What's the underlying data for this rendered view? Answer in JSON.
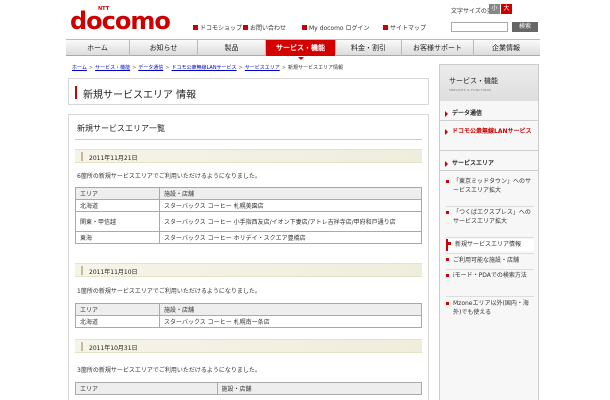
{
  "header": {
    "logo_ntt": "NTT",
    "logo_text": "docomo",
    "font_size_label": "文字サイズの変更",
    "font_small": "小",
    "font_large": "大",
    "search_placeholder": "",
    "search_button": "検索",
    "links": [
      {
        "label": "ドコモショップ"
      },
      {
        "label": "お問い合わせ"
      },
      {
        "label": "My docomo ログイン"
      },
      {
        "label": "サイトマップ"
      }
    ]
  },
  "gnav": [
    {
      "label": "ホーム"
    },
    {
      "label": "お知らせ"
    },
    {
      "label": "製品"
    },
    {
      "label": "サービス・機能",
      "active": true
    },
    {
      "label": "料金・割引"
    },
    {
      "label": "お客様サポート"
    },
    {
      "label": "企業情報"
    }
  ],
  "breadcrumb": [
    {
      "label": "ホーム"
    },
    {
      "label": "サービス・機能"
    },
    {
      "label": "データ通信"
    },
    {
      "label": "ドコモ公衆無線LANサービス"
    },
    {
      "label": "サービスエリア"
    },
    {
      "label": "新規サービスエリア情報"
    }
  ],
  "page_title": "新規サービスエリア 情報",
  "section_title": "新規サービスエリア一覧",
  "table_headers": {
    "area": "エリア",
    "facility": "施設・店舗"
  },
  "entries": [
    {
      "date": "2011年11月21日",
      "intro": "6箇所の新規サービスエリアでご利用いただけるようになりました。",
      "rows": [
        {
          "area": "北海道",
          "facility": "スターバックス コーヒー 札幌美園店"
        },
        {
          "area": "関東・甲信越",
          "facility": "スターバックス コーヒー 小手指西友店/イオン下妻店/アトレ吉祥寺店/甲府和戸通り店"
        },
        {
          "area": "東海",
          "facility": "スターバックス コーヒー ホリデイ・スクエア豊橋店"
        }
      ]
    },
    {
      "date": "2011年11月10日",
      "intro": "1箇所の新規サービスエリアでご利用いただけるようになりました。",
      "rows": [
        {
          "area": "北海道",
          "facility": "スターバックス コーヒー 札幌南一条店"
        }
      ]
    },
    {
      "date": "2011年10月31日",
      "intro": "3箇所の新規サービスエリアでご利用いただけるようになりました。",
      "rows": []
    }
  ],
  "sidebar": {
    "title": "サービス・機能",
    "subtitle": "SERVICES & FUNCTIONS",
    "sections": [
      {
        "label": "データ通信",
        "red": false
      },
      {
        "label": "ドコモ公衆無線LANサービス",
        "red": true
      },
      {
        "label": "サービスエリア",
        "red": false
      }
    ],
    "items": [
      {
        "label": "「東京ミッドタウン」へのサービスエリア拡大"
      },
      {
        "label": "「つくばエクスプレス」へのサービスエリア拡大"
      },
      {
        "label": "新規サービスエリア情報",
        "active": true
      },
      {
        "label": "ご利用可能な施設・店舗"
      },
      {
        "label": "iモード・PDAでの検索方法"
      },
      {
        "label": "Mzoneエリア以外(国内・海外)でも使える"
      }
    ]
  }
}
